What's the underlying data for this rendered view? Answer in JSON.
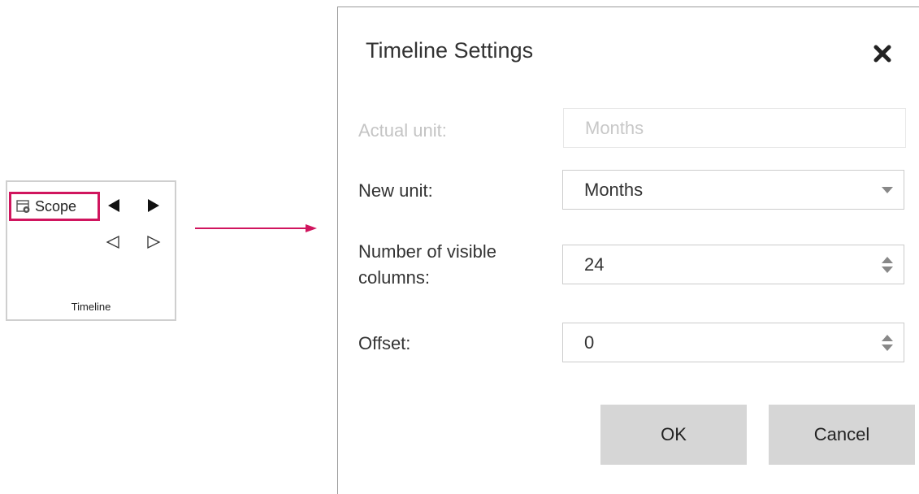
{
  "ribbon": {
    "scope_label": "Scope",
    "group_label": "Timeline",
    "highlight_color": "#d0155e",
    "icons": {
      "scope": "calendar-gear-icon",
      "prev_filled": "triangle-left-filled-icon",
      "next_filled": "triangle-right-filled-icon",
      "prev_outline": "triangle-left-outline-icon",
      "next_outline": "triangle-right-outline-icon"
    }
  },
  "arrow": {
    "color": "#d0155e"
  },
  "dialog": {
    "title": "Timeline Settings",
    "close_icon": "close-x-icon",
    "fields": {
      "actual_unit": {
        "label": "Actual unit:",
        "value": "Months"
      },
      "new_unit": {
        "label": "New unit:",
        "value": "Months"
      },
      "visible_columns": {
        "label_line1": "Number of visible",
        "label_line2": "columns:",
        "value": "24"
      },
      "offset": {
        "label": "Offset:",
        "value": "0"
      }
    },
    "buttons": {
      "ok": "OK",
      "cancel": "Cancel"
    }
  }
}
